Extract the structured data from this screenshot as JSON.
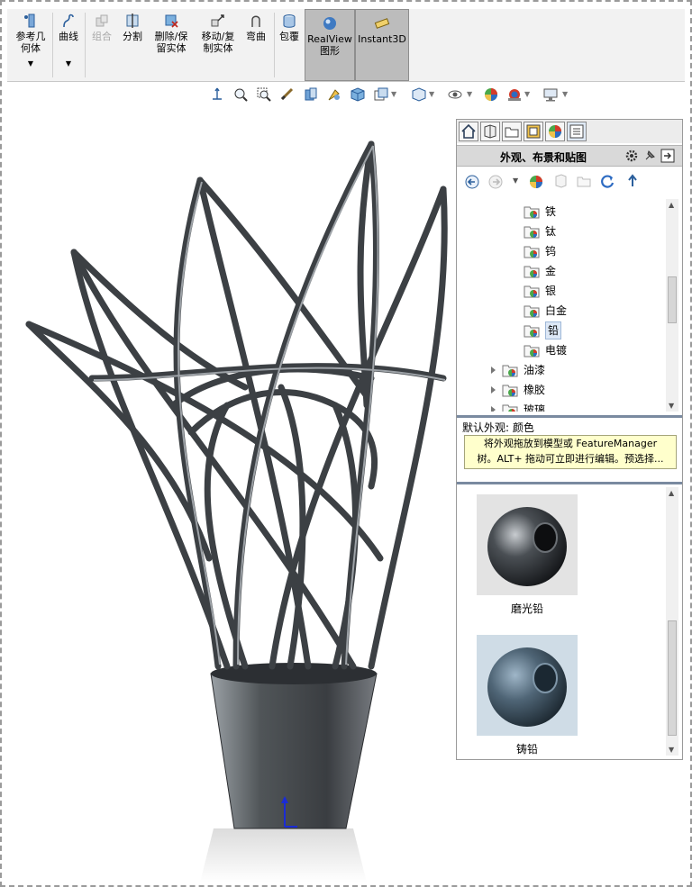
{
  "ribbon": {
    "ref_geometry": "参考几何体",
    "curves": "曲线",
    "combine": "组合",
    "split": "分割",
    "delete_keep": "删除/保留实体",
    "move_copy": "移动/复制实体",
    "flex": "弯曲",
    "wrap": "包覆",
    "realview": "RealView 图形",
    "instant3d": "Instant3D"
  },
  "view_toolbar": {
    "icons": [
      "view-orientation-icon",
      "zoom-to-fit-icon",
      "zoom-to-area-icon",
      "previous-view-icon",
      "section-view-icon",
      "dynamic-annotation-icon",
      "view-orientation-cube-icon",
      "display-style-icon",
      "hide-show-items-icon",
      "edit-appearance-icon",
      "apply-scene-icon",
      "view-settings-icon"
    ]
  },
  "task_pane": {
    "title": "外观、布景和贴图",
    "tree": [
      {
        "label": "铁"
      },
      {
        "label": "钛"
      },
      {
        "label": "钨"
      },
      {
        "label": "金"
      },
      {
        "label": "银"
      },
      {
        "label": "白金"
      },
      {
        "label": "铅",
        "selected": true
      },
      {
        "label": "电镀"
      },
      {
        "label": "油漆",
        "expandable": true
      },
      {
        "label": "橡胶",
        "expandable": true
      },
      {
        "label": "玻璃",
        "expandable": true
      }
    ],
    "default_appearance": "默认外观: 颜色",
    "tip_line1": "将外观拖放到模型或 FeatureManager",
    "tip_line2": "树。ALT+ 拖动可立即进行编辑。预选择...",
    "swatches": [
      {
        "label": "磨光铅",
        "color": "#3a3f44"
      },
      {
        "label": "铸铅",
        "color": "#4a6072"
      }
    ]
  },
  "colors": {
    "model_metal": "#5e6266",
    "ribbon_bg": "#f2f2f2",
    "pressed_bg": "#bcbcbc",
    "tip_bg": "#ffffcc",
    "axis_blue": "#1a2bd6"
  }
}
